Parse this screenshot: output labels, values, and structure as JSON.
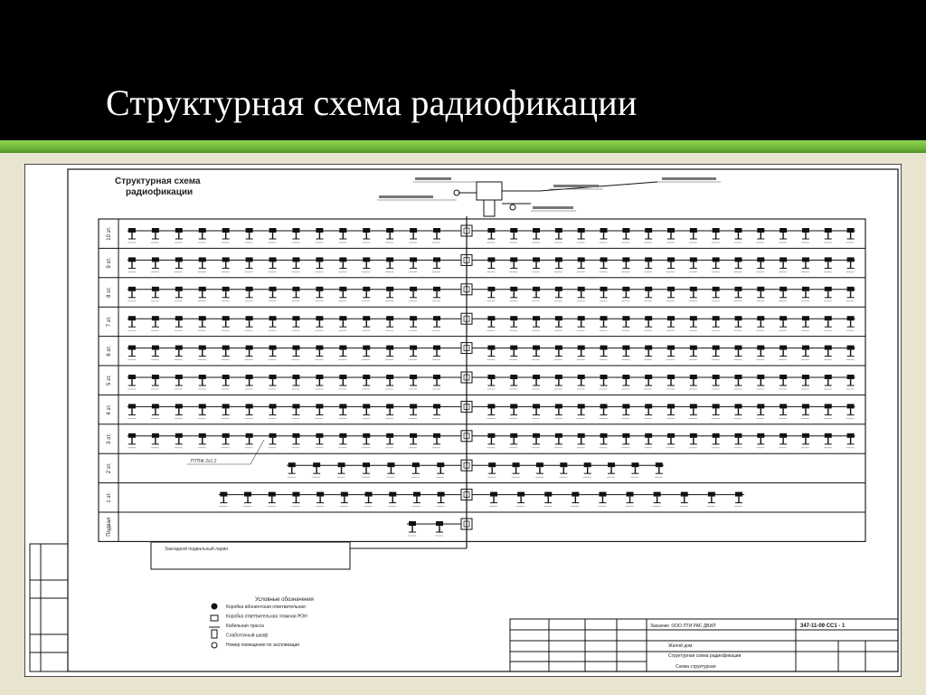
{
  "slide": {
    "title": "Структурная схема радиофикации"
  },
  "colors": {
    "header_background": "#000000",
    "title_text": "#ffffff",
    "accent_bar": "#6fb83a",
    "content_background": "#e8e4d0",
    "drawing_paper": "#ffffff",
    "drawing_lines": "#111111"
  },
  "drawing": {
    "title_line_1": "Структурная схема",
    "title_line_2": "радиофикации",
    "riser_label": "ПТПЖ 2х1,2",
    "floors": [
      {
        "label": "10 эт.",
        "left_outlets": 14,
        "right_outlets": 17
      },
      {
        "label": "9 эт.",
        "left_outlets": 14,
        "right_outlets": 17
      },
      {
        "label": "8 эт.",
        "left_outlets": 14,
        "right_outlets": 17
      },
      {
        "label": "7 эт.",
        "left_outlets": 14,
        "right_outlets": 17
      },
      {
        "label": "6 эт.",
        "left_outlets": 14,
        "right_outlets": 17
      },
      {
        "label": "5 эт.",
        "left_outlets": 14,
        "right_outlets": 17
      },
      {
        "label": "4 эт.",
        "left_outlets": 14,
        "right_outlets": 17
      },
      {
        "label": "3 эт.",
        "left_outlets": 14,
        "right_outlets": 17
      },
      {
        "label": "2 эт.",
        "left_outlets": 7,
        "right_outlets": 8
      },
      {
        "label": "1 эт.",
        "left_outlets": 10,
        "right_outlets": 10
      },
      {
        "label": "Подвал",
        "left_outlets": 2,
        "right_outlets": 0
      }
    ],
    "basement_box_label": "Закладной подвальный ларин",
    "legend_title": "Условные обозначения",
    "legend_items": [
      "Коробка абонентская ответвительная",
      "Коробка ответвительная этажная РОН",
      "Кабельная трасса",
      "Слаботочный шкаф",
      "Номер помещения по экспликации"
    ],
    "stamp": {
      "code": "347-11-09 СС1 - 1",
      "row_1": "Заказчик: ООО ЛТИ РАС ДВИЛ",
      "row_2": "Жилой дом",
      "row_3": "Структурная схема радиофикации",
      "row_4": "Схема структурная"
    }
  }
}
